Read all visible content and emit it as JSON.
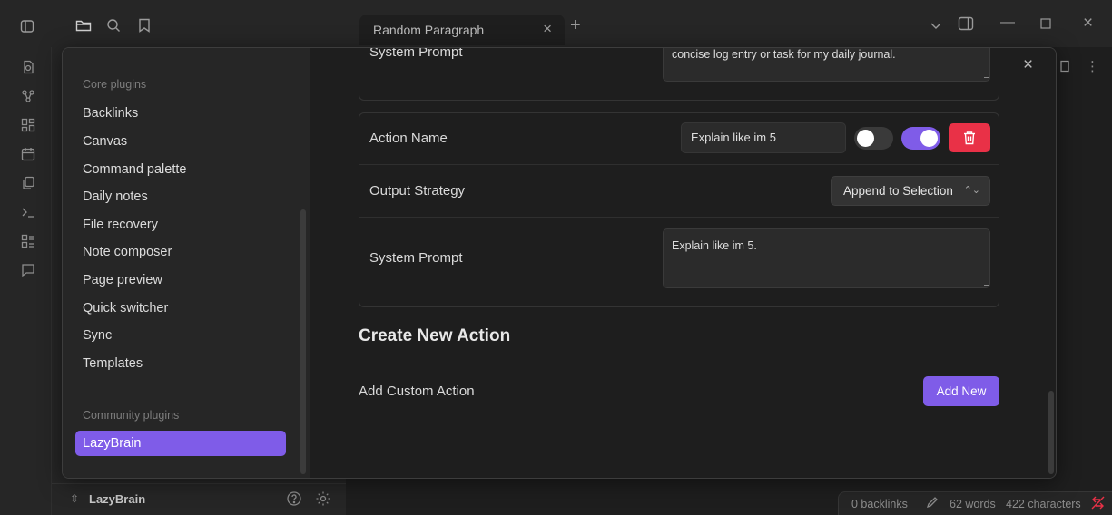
{
  "tab": {
    "title": "Random Paragraph"
  },
  "colors": {
    "accent": "#7f5ce8",
    "danger": "#e93147",
    "background": "#1e1e1e",
    "sidebar": "#262626"
  },
  "settings_nav": {
    "core_heading": "Core plugins",
    "core_items": [
      "Backlinks",
      "Canvas",
      "Command palette",
      "Daily notes",
      "File recovery",
      "Note composer",
      "Page preview",
      "Quick switcher",
      "Sync",
      "Templates"
    ],
    "community_heading": "Community plugins",
    "community_items": [
      "LazyBrain"
    ]
  },
  "previous_action": {
    "system_prompt_label": "System Prompt",
    "system_prompt_value": "concise log entry or task for my daily journal."
  },
  "action": {
    "name_label": "Action Name",
    "name_value": "Explain like im 5",
    "toggle_1_on": false,
    "toggle_2_on": true,
    "output_label": "Output Strategy",
    "output_value": "Append to Selection",
    "system_prompt_label": "System Prompt",
    "system_prompt_value": "Explain like im 5."
  },
  "create_section": {
    "title": "Create New Action",
    "custom_label": "Add Custom Action",
    "add_button": "Add New"
  },
  "vault": {
    "name": "LazyBrain"
  },
  "status": {
    "backlinks": "0 backlinks",
    "words": "62 words",
    "characters": "422 characters"
  }
}
